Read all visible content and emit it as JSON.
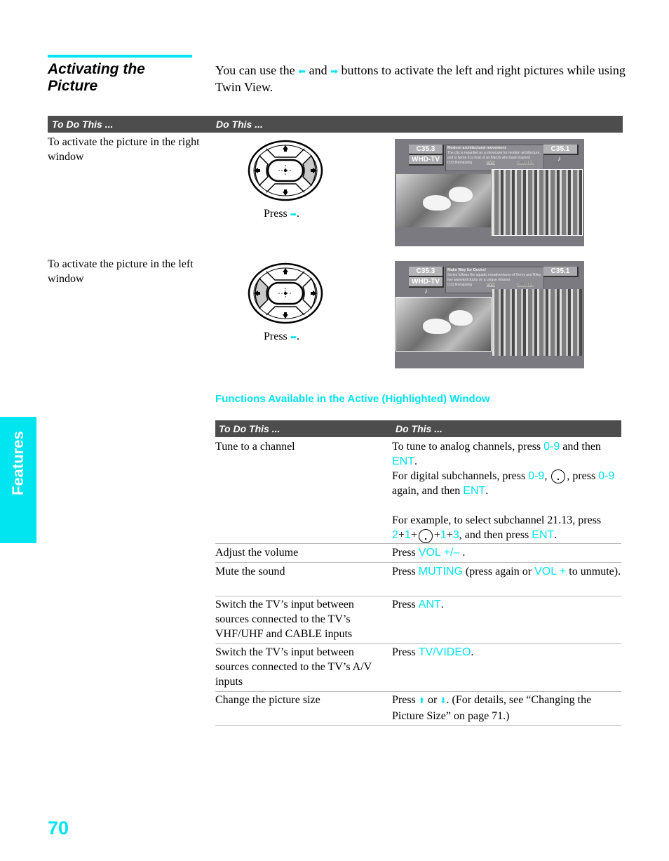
{
  "section": {
    "title_line1": "Activating the",
    "title_line2": "Picture",
    "intro_a": "You can use the ",
    "intro_left_arrow": "⬅",
    "intro_b": " and ",
    "intro_right_arrow": "➡",
    "intro_c": " buttons to activate the left and right pictures while using Twin View."
  },
  "table1": {
    "headers": [
      "To Do This ...",
      "Do This ..."
    ],
    "rows": [
      {
        "task": "To activate the picture in the right window",
        "press_label": "Press ",
        "press_icon": "right-arrow-icon",
        "press_glyph": "➡",
        "press_end": ".",
        "highlighted_button": "right",
        "screen": {
          "left_channel": "C35.3",
          "left_station": "WHD-TV",
          "right_channel": "C35.1",
          "audio_icon": "♪",
          "audio_side": "right",
          "program_title": "Modern architectural movement",
          "program_desc": "The city is regarded as a showcase for modern architecture, and is home to a host of architects who have inspired international architectural styles.",
          "remaining": "0:33 Remaining",
          "badge1": "TV-G",
          "badge2": "1080i",
          "badge3": "16:9"
        }
      },
      {
        "task": "To activate the picture in the left window",
        "press_label": "Press ",
        "press_icon": "left-arrow-icon",
        "press_glyph": "⬅",
        "press_end": ".",
        "highlighted_button": "left",
        "screen": {
          "left_channel": "C35.3",
          "left_station": "WHD-TV",
          "right_channel": "C35.1",
          "audio_icon": "♪",
          "audio_side": "left",
          "program_title": "Make Way for Ducks!",
          "program_desc": "Series follows the aquatic misadventures of Henry and Riley, two wayward ducks on a unique mission.",
          "remaining": "0:33 Remaining",
          "badge1": "TV-G",
          "badge2": "1080i",
          "badge3": "16:9"
        }
      }
    ]
  },
  "functions": {
    "title": "Functions Available in the Active (Highlighted) Window",
    "headers": [
      "To Do This ...",
      "Do This ..."
    ],
    "rows": [
      {
        "task": "Tune to a channel",
        "p1a": "To tune to analog channels, press ",
        "p1k": "0-9",
        "p1b": " and then ",
        "p1k2": "ENT",
        "p1c": ".",
        "p2a": "For digital subchannels, press ",
        "p2k": "0-9",
        "p2b": ", ",
        "p2c": ", press ",
        "p2k2": "0-9",
        "p2d": " again, and then ",
        "p2k3": "ENT",
        "p2e": ".",
        "p3a": "For example, to select subchannel 21.13, press ",
        "p3k1": "2",
        "p3s1": "+",
        "p3k2": "1",
        "p3s2": "+",
        "p3s3": "+",
        "p3k3": "1",
        "p3s4": "+",
        "p3k4": "3",
        "p3b": ", and then press ",
        "p3k5": "ENT",
        "p3c": "."
      },
      {
        "task": "Adjust the volume",
        "a": "Press ",
        "k": "VOL +/–",
        "b": " ."
      },
      {
        "task": "Mute the sound",
        "a": "Press ",
        "k": "MUTING",
        "b": " (press again or ",
        "k2": "VOL +",
        "c": " to unmute)."
      },
      {
        "task": "Switch the TV’s input between sources connected to the TV’s VHF/UHF and CABLE inputs",
        "a": "Press ",
        "k": "ANT",
        "b": "."
      },
      {
        "task": "Switch the TV’s input between sources connected to the TV’s A/V inputs",
        "a": "Press ",
        "k": "TV/VIDEO",
        "b": "."
      },
      {
        "task": "Change the picture size",
        "a": "Press ",
        "up": "⬆",
        "or": " or ",
        "down": "⬇",
        "b": ". (For details, see “Changing the Picture Size” on page 71.)"
      }
    ]
  },
  "side_tab": "Features",
  "page_number": "70",
  "colors": {
    "accent": "#00e5f0",
    "header_bg": "#4d4d4d"
  }
}
